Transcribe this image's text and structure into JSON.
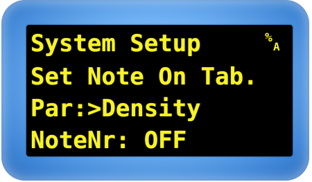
{
  "display": {
    "line1": "System Setup",
    "line2": "Set Note On Tab.",
    "line3": "Par:>Density",
    "line4": "NoteNr: OFF",
    "mode_icon_top": "%",
    "mode_icon_bottom": "A"
  },
  "colors": {
    "text": "#f7f324",
    "screen": "#000000",
    "bezel": "#6fb0f2"
  }
}
